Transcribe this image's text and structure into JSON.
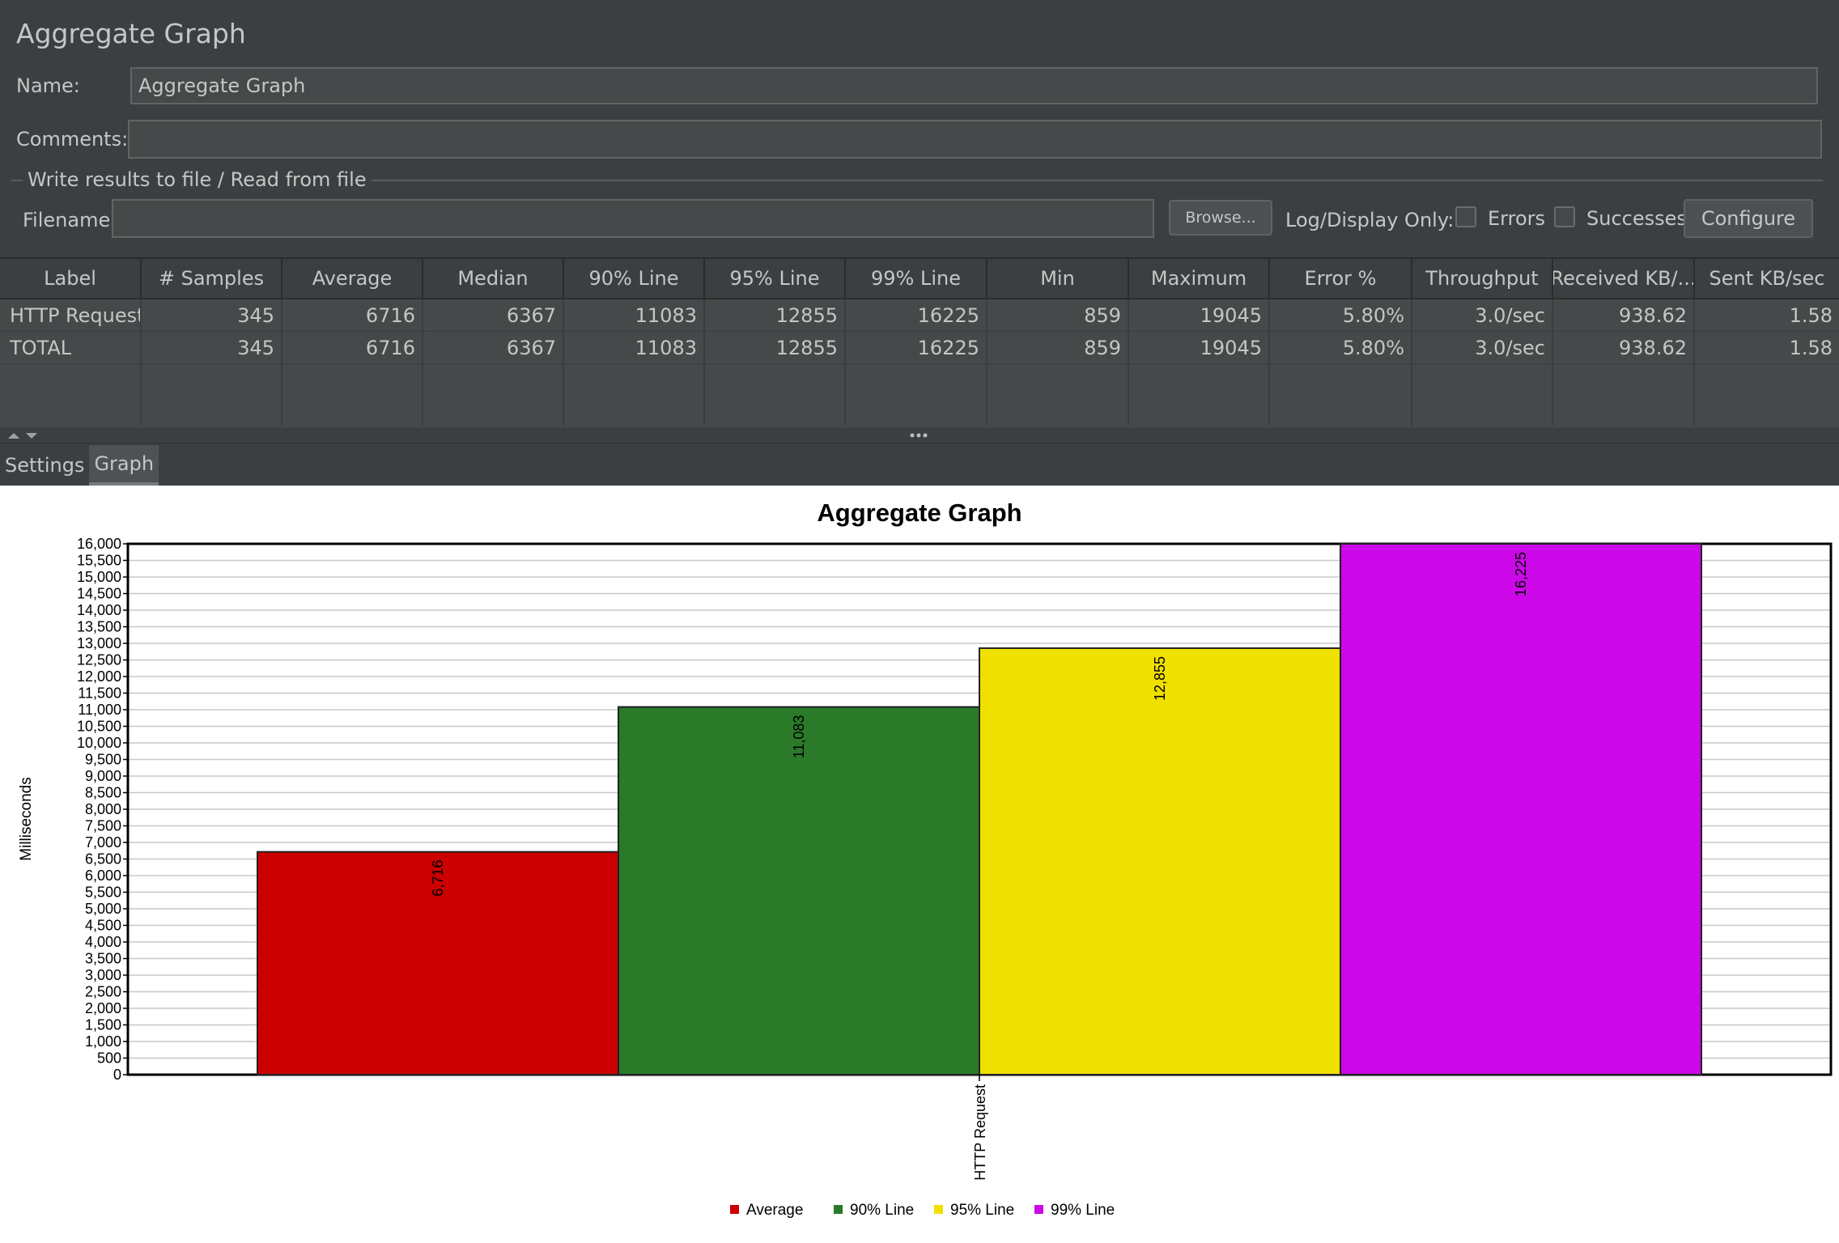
{
  "panel": {
    "title": "Aggregate Graph"
  },
  "form": {
    "name_label": "Name:",
    "name_value": "Aggregate Graph",
    "comments_label": "Comments:",
    "comments_value": "",
    "file_group_title": "Write results to file / Read from file",
    "filename_label": "Filename",
    "filename_value": "",
    "browse_label": "Browse...",
    "log_display_label": "Log/Display Only:",
    "errors_label": "Errors",
    "errors_checked": false,
    "successes_label": "Successes",
    "successes_checked": false,
    "configure_label": "Configure"
  },
  "table": {
    "columns": [
      "Label",
      "# Samples",
      "Average",
      "Median",
      "90% Line",
      "95% Line",
      "99% Line",
      "Min",
      "Maximum",
      "Error %",
      "Throughput",
      "Received KB/...",
      "Sent KB/sec"
    ],
    "rows": [
      [
        "HTTP Request",
        "345",
        "6716",
        "6367",
        "11083",
        "12855",
        "16225",
        "859",
        "19045",
        "5.80%",
        "3.0/sec",
        "938.62",
        "1.58"
      ],
      [
        "TOTAL",
        "345",
        "6716",
        "6367",
        "11083",
        "12855",
        "16225",
        "859",
        "19045",
        "5.80%",
        "3.0/sec",
        "938.62",
        "1.58"
      ]
    ]
  },
  "tabs": [
    {
      "label": "Settings",
      "active": false
    },
    {
      "label": "Graph",
      "active": true
    }
  ],
  "chart_data": {
    "type": "bar",
    "title": "Aggregate Graph",
    "xlabel": "",
    "ylabel": "Milliseconds",
    "categories": [
      "HTTP Request"
    ],
    "series": [
      {
        "name": "Average",
        "values": [
          6716
        ],
        "color": "#cc0000",
        "label": "6,716"
      },
      {
        "name": "90% Line",
        "values": [
          11083
        ],
        "color": "#2a7a2a",
        "label": "11,083"
      },
      {
        "name": "95% Line",
        "values": [
          12855
        ],
        "color": "#f0e000",
        "label": "12,855"
      },
      {
        "name": "99% Line",
        "values": [
          16225
        ],
        "color": "#cc08e8",
        "label": "16,225"
      }
    ],
    "ylim": [
      0,
      16000
    ],
    "ytick_step": 500,
    "grid": true,
    "legend": "bottom"
  }
}
